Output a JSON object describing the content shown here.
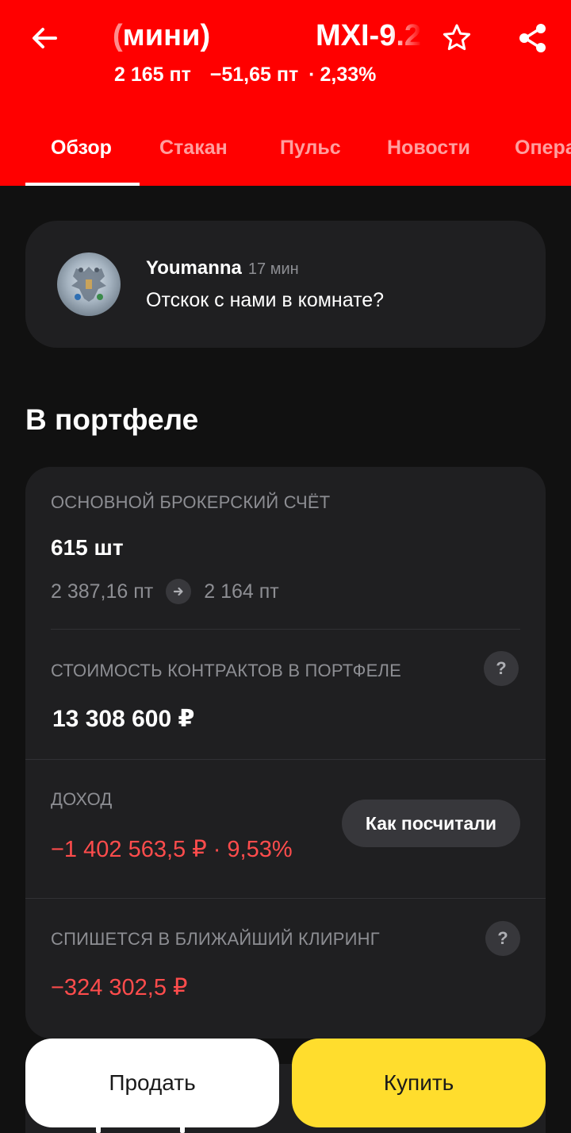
{
  "header": {
    "back_icon": "arrow-left-icon",
    "title_left": "мини)",
    "title_left_prefix": "(",
    "title_right": "MXI-9.2",
    "price": "2 165 пт",
    "change": "−51,65 пт",
    "separator": "·",
    "change_percent": "2,33%",
    "star_icon": "star-outline-icon",
    "share_icon": "share-icon",
    "background_color": "#ff0000"
  },
  "tabs": [
    {
      "label": "Обзор",
      "active": true
    },
    {
      "label": "Стакан",
      "active": false
    },
    {
      "label": "Пульс",
      "active": false
    },
    {
      "label": "Новости",
      "active": false
    },
    {
      "label": "Опера",
      "active": false
    }
  ],
  "pulse": {
    "author": "Youmanna",
    "time": "17 мин",
    "text": "Отскок с нами в комнате?",
    "avatar_icon": "double-headed-eagle-avatar"
  },
  "portfolio": {
    "title": "В портфеле",
    "account_label": "ОСНОВНОЙ БРОКЕРСКИЙ СЧЁТ",
    "quantity": "615 шт",
    "avg_price": "2 387,16 пт",
    "current_price": "2 164 пт",
    "value_label": "СТОИМОСТЬ КОНТРАКТОВ В ПОРТФЕЛЕ",
    "value": "13 308 600 ₽",
    "income_label": "ДОХОД",
    "income_value": "−1 402 563,5 ₽ · 9,53%",
    "how_calculated": "Как посчитали",
    "clearing_label": "СПИШЕТСЯ В БЛИЖАЙШИЙ КЛИРИНГ",
    "clearing_value": "−324 302,5 ₽",
    "help_icon": "question-mark-icon",
    "negative_color": "#ff4c4c"
  },
  "actions": {
    "sell": "Продать",
    "buy": "Купить",
    "buy_color": "#ffdd2d"
  }
}
